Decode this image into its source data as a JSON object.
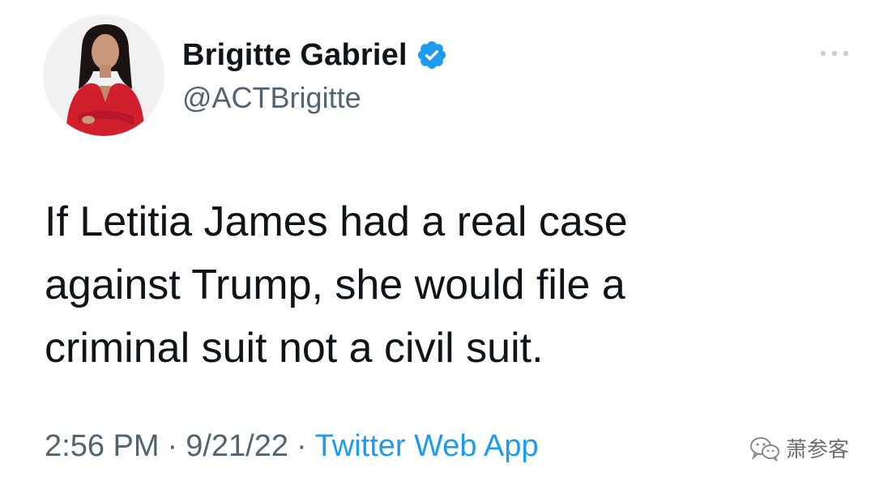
{
  "author": {
    "display_name": "Brigitte Gabriel",
    "handle": "@ACTBrigitte",
    "verified": true,
    "avatar_icon": "profile-photo"
  },
  "tweet": {
    "text": "If Letitia James had a real case\nagainst Trump, she would file a\ncriminal suit not a civil suit."
  },
  "meta": {
    "time": "2:56 PM",
    "separator": "·",
    "date": "9/21/22",
    "source": "Twitter Web App"
  },
  "more_icon": "more-horizontal-icon",
  "watermark": {
    "text": "萧参客",
    "icon": "wechat-icon"
  },
  "colors": {
    "text_primary": "#0f1419",
    "text_secondary": "#536471",
    "link": "#1d9bf0",
    "verified_badge": "#1d9bf0",
    "background": "#ffffff"
  }
}
